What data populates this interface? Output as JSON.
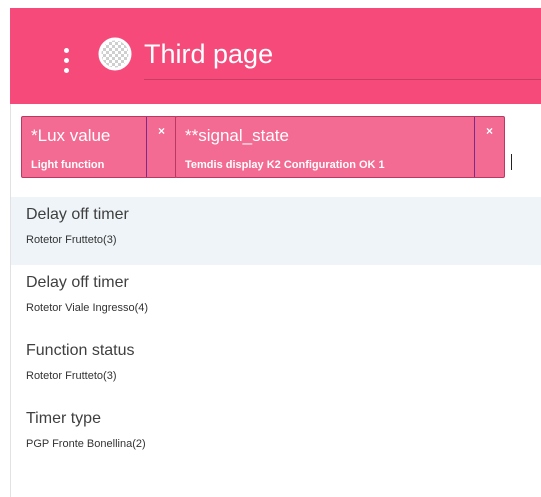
{
  "header": {
    "title": "Third page",
    "background_color": "#f64a7b",
    "menu_icon": "kebab-menu-icon",
    "page_icon": "checkered-circle-icon"
  },
  "selected_chips": [
    {
      "title": "*Lux value",
      "subtitle": "Light function",
      "remove_label": "×"
    },
    {
      "title": "**signal_state",
      "subtitle": "Temdis display K2 Configuration OK 1",
      "remove_label": "×"
    }
  ],
  "chip_color": "#f36a92",
  "options": [
    {
      "title": "Delay off timer",
      "subtitle": "Rotetor Frutteto(3)"
    },
    {
      "title": "Delay off timer",
      "subtitle": "Rotetor Viale Ingresso(4)"
    },
    {
      "title": "Function status",
      "subtitle": "Rotetor Frutteto(3)"
    },
    {
      "title": "Timer type",
      "subtitle": "PGP Fronte Bonellina(2)"
    }
  ],
  "highlight_color": "#eef4f8"
}
